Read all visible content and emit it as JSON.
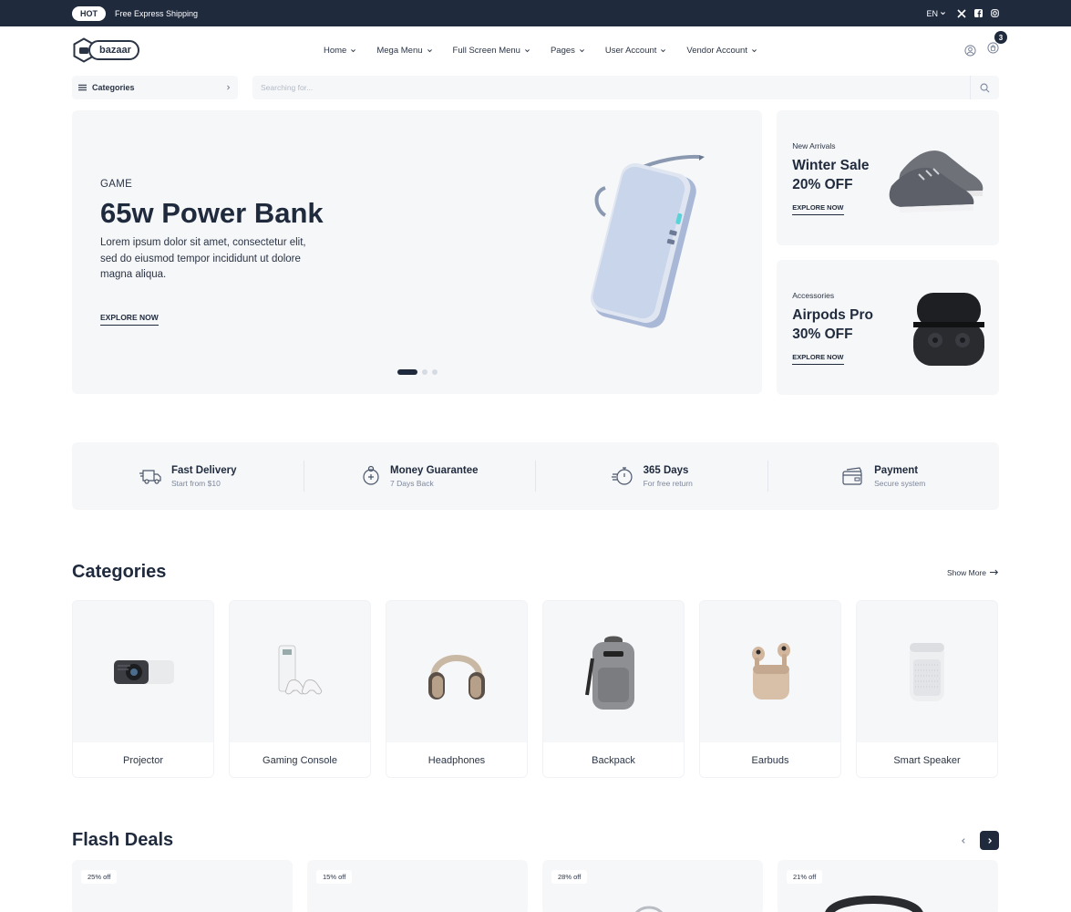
{
  "topbar": {
    "badge": "HOT",
    "message": "Free Express Shipping",
    "language": "EN",
    "social_icons": [
      "x-icon",
      "facebook-icon",
      "instagram-icon"
    ]
  },
  "header": {
    "logo_text": "bazaar",
    "nav": [
      "Home",
      "Mega Menu",
      "Full Screen Menu",
      "Pages",
      "User Account",
      "Vendor Account"
    ],
    "cart_count": "3"
  },
  "search": {
    "categories_label": "Categories",
    "placeholder": "Searching for..."
  },
  "hero": {
    "tag": "GAME",
    "title": "65w Power Bank",
    "description": "Lorem ipsum dolor sit amet, consectetur elit, sed do eiusmod tempor incididunt ut dolore magna aliqua.",
    "cta": "EXPLORE NOW",
    "slides": 3,
    "active_slide": 1
  },
  "promos": [
    {
      "subtitle": "New Arrivals",
      "title": "Winter Sale 20% OFF",
      "cta": "EXPLORE NOW",
      "image": "sneaker"
    },
    {
      "subtitle": "Accessories",
      "title": "Airpods Pro 30% OFF",
      "cta": "EXPLORE NOW",
      "image": "earbuds-case"
    }
  ],
  "services": [
    {
      "icon": "truck-icon",
      "title": "Fast Delivery",
      "subtitle": "Start from $10"
    },
    {
      "icon": "piggy-bank-icon",
      "title": "Money Guarantee",
      "subtitle": "7 Days Back"
    },
    {
      "icon": "stopwatch-icon",
      "title": "365 Days",
      "subtitle": "For free return"
    },
    {
      "icon": "credit-card-icon",
      "title": "Payment",
      "subtitle": "Secure system"
    }
  ],
  "categories": {
    "heading": "Categories",
    "show_more": "Show More",
    "items": [
      {
        "label": "Projector"
      },
      {
        "label": "Gaming Console"
      },
      {
        "label": "Headphones"
      },
      {
        "label": "Backpack"
      },
      {
        "label": "Earbuds"
      },
      {
        "label": "Smart Speaker"
      }
    ]
  },
  "flash_deals": {
    "heading": "Flash Deals",
    "items": [
      {
        "discount": "25% off"
      },
      {
        "discount": "15% off"
      },
      {
        "discount": "28% off"
      },
      {
        "discount": "21% off"
      }
    ]
  },
  "colors": {
    "navy": "#1f2a3d",
    "panel": "#f6f7f9",
    "text": "#2b3445",
    "muted": "#7d879c"
  }
}
